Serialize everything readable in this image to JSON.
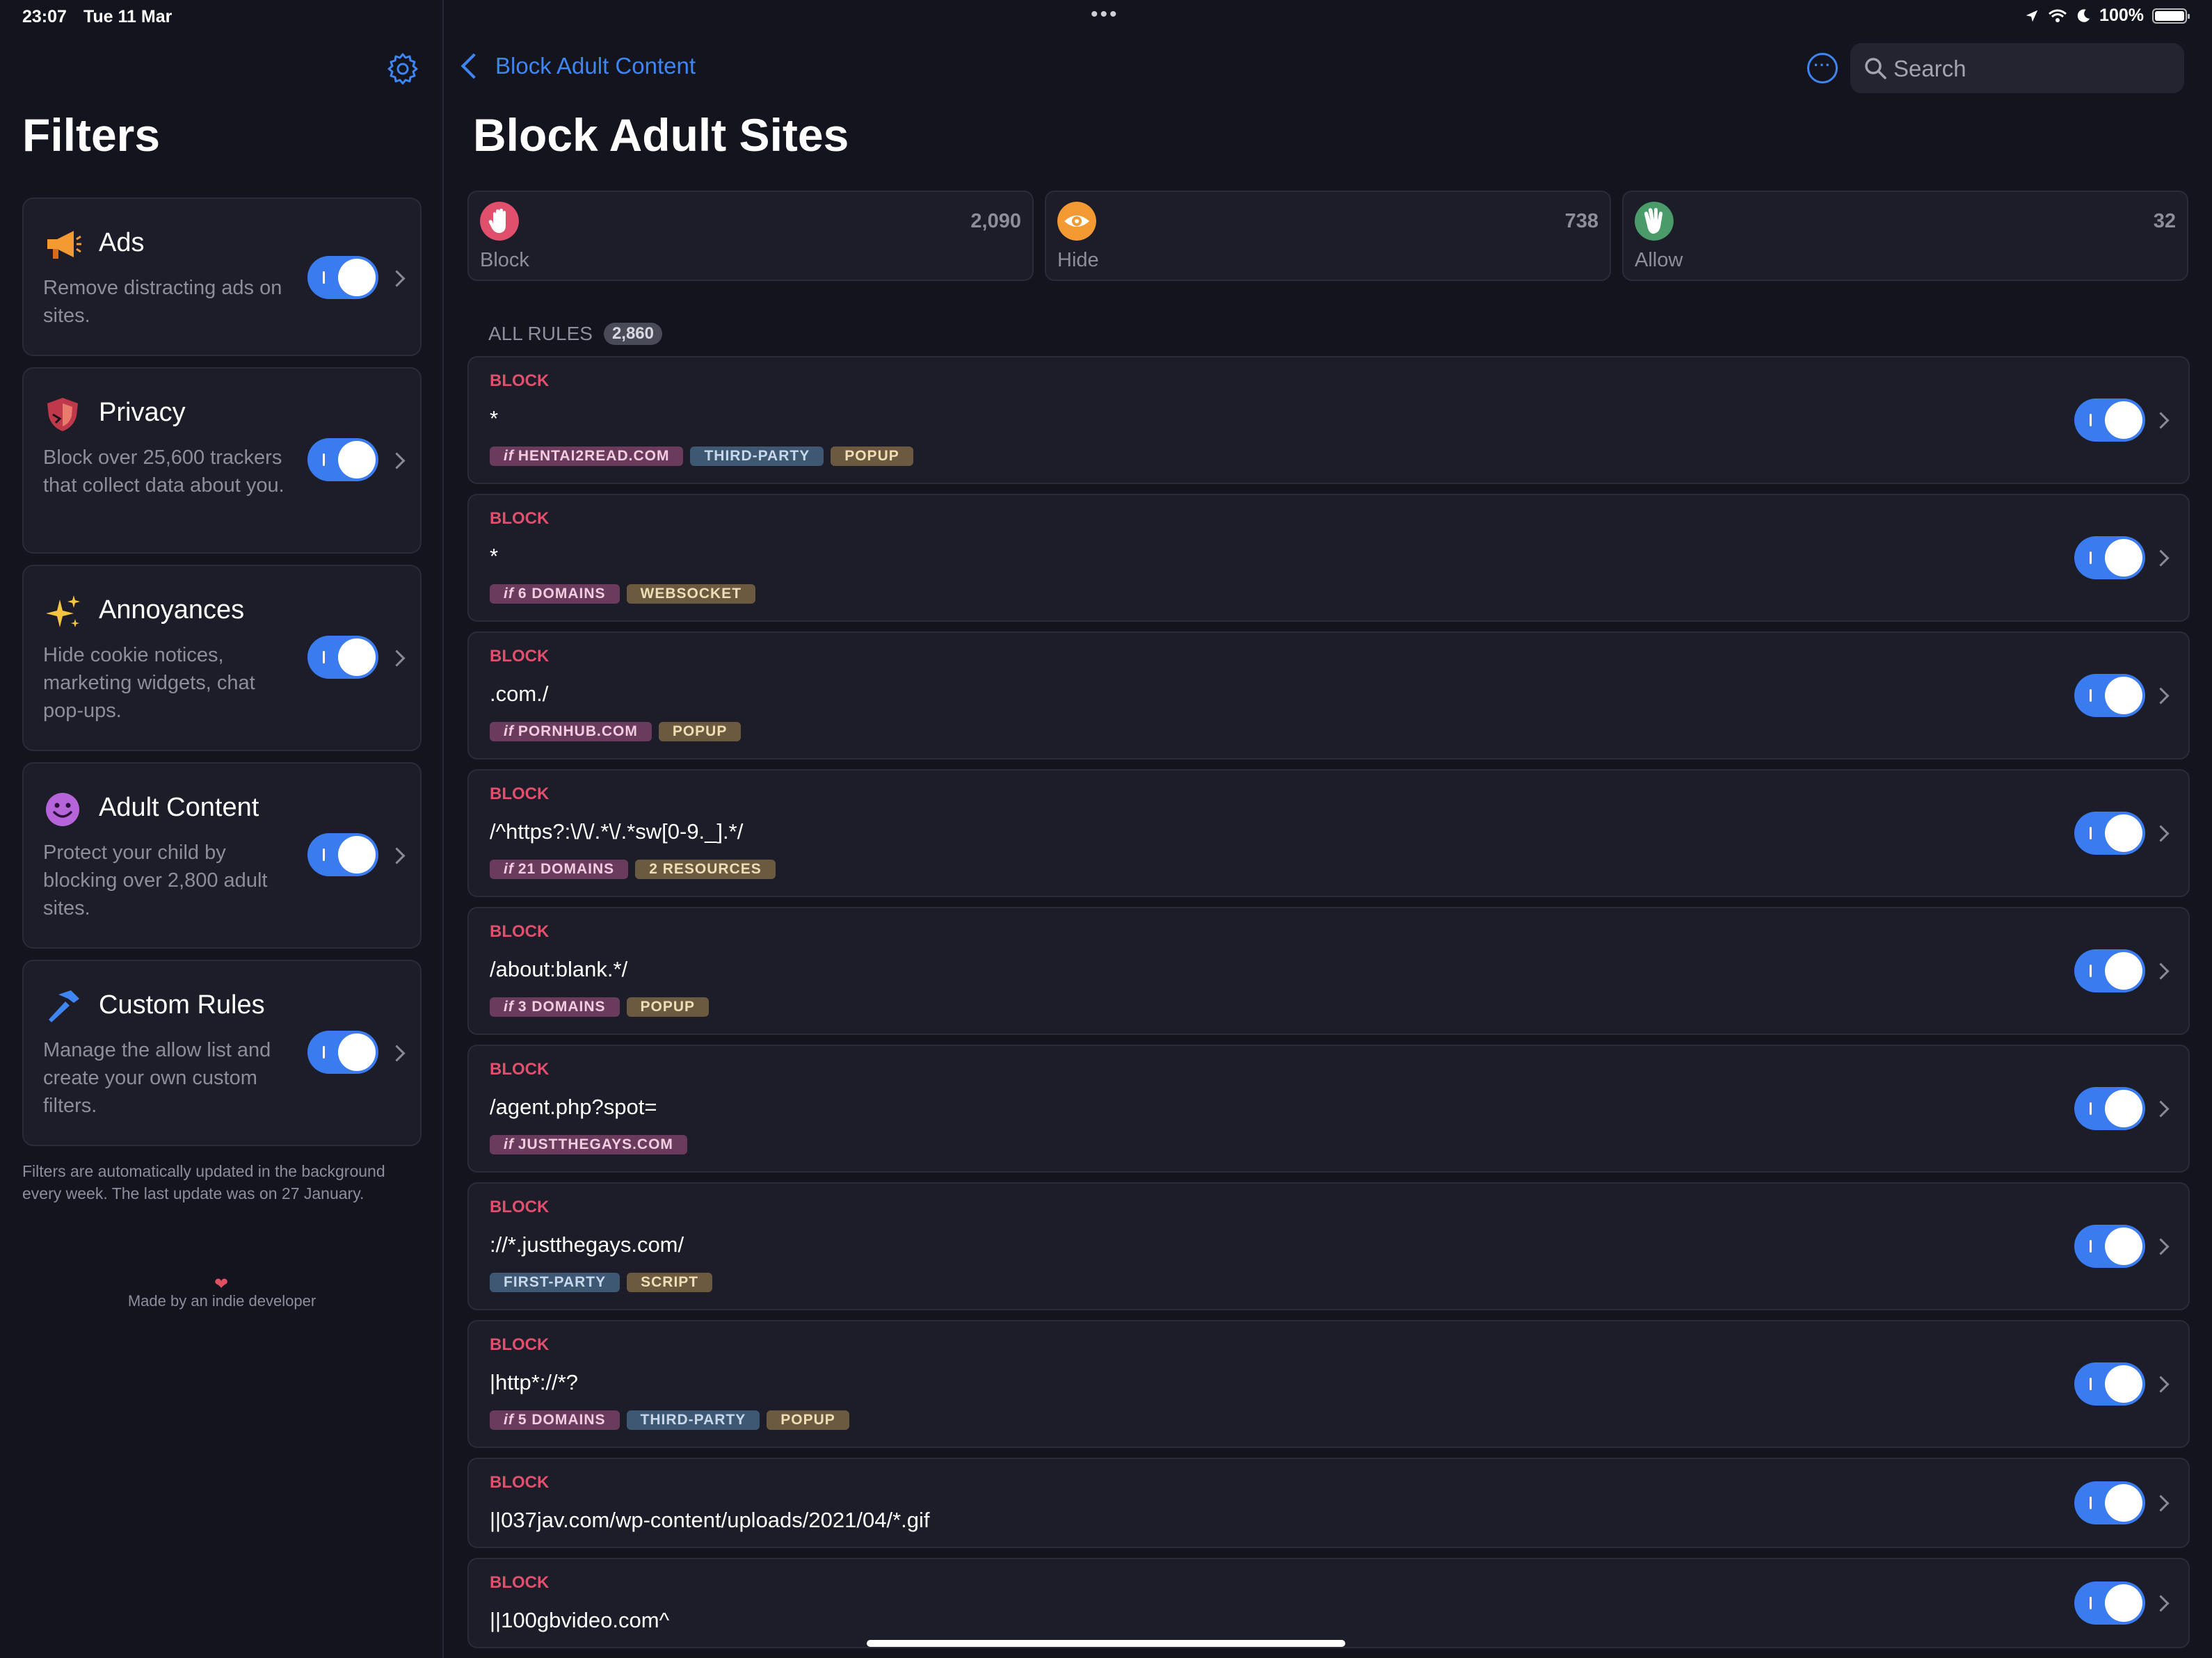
{
  "status": {
    "time": "23:07",
    "date": "Tue 11 Mar",
    "more": "•••",
    "battery": "100%"
  },
  "sidebar": {
    "title": "Filters",
    "items": [
      {
        "title": "Ads",
        "description": "Remove distracting ads on sites.",
        "icon": "megaphone-icon"
      },
      {
        "title": "Privacy",
        "description": "Block over 25,600 trackers that collect data about you.",
        "icon": "shield-icon"
      },
      {
        "title": "Annoyances",
        "description": "Hide cookie notices, marketing widgets, chat pop-ups.",
        "icon": "sparkles-icon"
      },
      {
        "title": "Adult Content",
        "description": "Protect your child by blocking over 2,800 adult sites.",
        "icon": "smiley-icon"
      },
      {
        "title": "Custom Rules",
        "description": "Manage the allow list and create your own custom filters.",
        "icon": "hammer-icon"
      }
    ],
    "footnote": "Filters are automatically updated in the background every week. The last update was on 27 January.",
    "heart": "❤",
    "madeby": "Made by an indie developer"
  },
  "main": {
    "back_label": "Block Adult Content",
    "more_glyph": "···",
    "search_placeholder": "Search",
    "title": "Block Adult Sites",
    "stats": [
      {
        "label": "Block",
        "count": "2,090",
        "color": "#e0506c",
        "icon": "hand-icon"
      },
      {
        "label": "Hide",
        "count": "738",
        "color": "#f39a32",
        "icon": "eye-icon"
      },
      {
        "label": "Allow",
        "count": "32",
        "color": "#4b9b6a",
        "icon": "wave-hand-icon"
      }
    ],
    "section_label": "ALL RULES",
    "section_count": "2,860",
    "domain_prefix": "if",
    "rules": [
      {
        "type": "BLOCK",
        "text": "*",
        "domain": "HENTAI2READ.COM",
        "tags": [
          {
            "label": "THIRD-PARTY",
            "kind": "party"
          },
          {
            "label": "POPUP",
            "kind": "type"
          }
        ]
      },
      {
        "type": "BLOCK",
        "text": "*",
        "domain": "6 DOMAINS",
        "tags": [
          {
            "label": "WEBSOCKET",
            "kind": "type"
          }
        ]
      },
      {
        "type": "BLOCK",
        "text": ".com./",
        "domain": "PORNHUB.COM",
        "tags": [
          {
            "label": "POPUP",
            "kind": "type"
          }
        ]
      },
      {
        "type": "BLOCK",
        "text": "/^https?:\\/\\/.*\\/.*sw[0-9._].*/",
        "domain": "21 DOMAINS",
        "tags": [
          {
            "label": "2 RESOURCES",
            "kind": "type"
          }
        ]
      },
      {
        "type": "BLOCK",
        "text": "/about:blank.*/",
        "domain": "3 DOMAINS",
        "tags": [
          {
            "label": "POPUP",
            "kind": "type"
          }
        ]
      },
      {
        "type": "BLOCK",
        "text": "/agent.php?spot=",
        "domain": "JUSTTHEGAYS.COM",
        "tags": []
      },
      {
        "type": "BLOCK",
        "text": "://*.justthegays.com/",
        "domain": "",
        "tags": [
          {
            "label": "FIRST-PARTY",
            "kind": "party"
          },
          {
            "label": "SCRIPT",
            "kind": "type"
          }
        ]
      },
      {
        "type": "BLOCK",
        "text": "|http*://*?",
        "domain": "5 DOMAINS",
        "tags": [
          {
            "label": "THIRD-PARTY",
            "kind": "party"
          },
          {
            "label": "POPUP",
            "kind": "type"
          }
        ]
      },
      {
        "type": "BLOCK",
        "text": "||037jav.com/wp-content/uploads/2021/04/*.gif",
        "domain": "",
        "tags": []
      },
      {
        "type": "BLOCK",
        "text": "||100gbvideo.com^",
        "domain": "",
        "tags": []
      }
    ]
  }
}
